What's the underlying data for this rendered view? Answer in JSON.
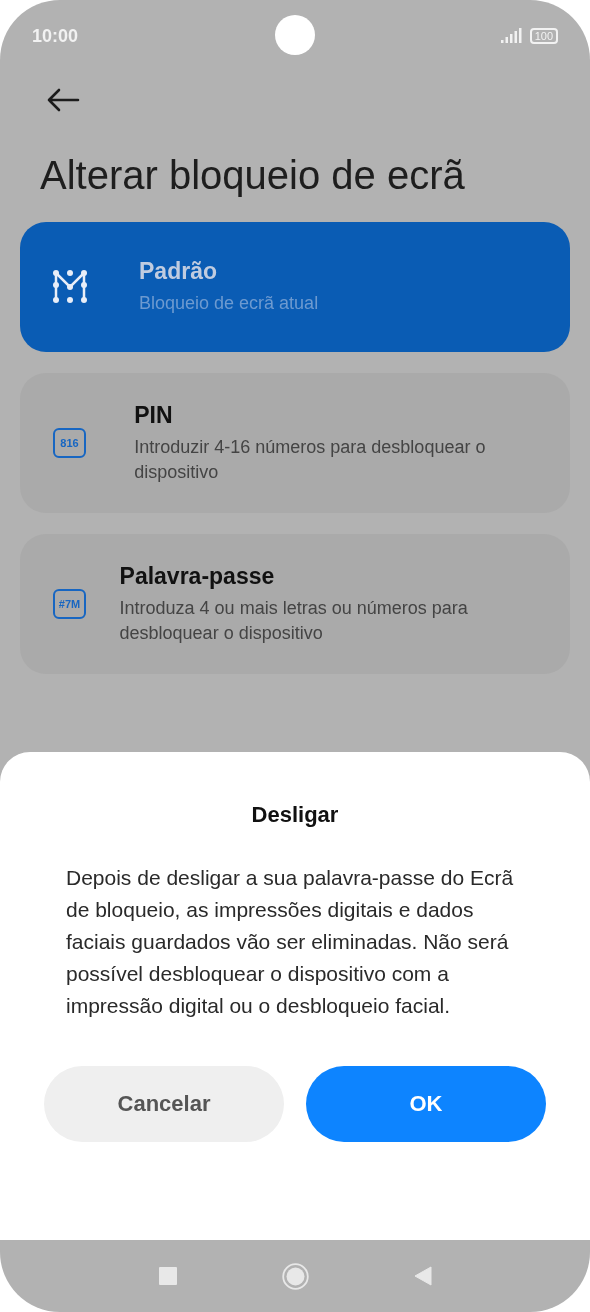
{
  "status_bar": {
    "time": "10:00",
    "battery": "100"
  },
  "header": {
    "title": "Alterar bloqueio de ecrã"
  },
  "options": [
    {
      "kind": "pattern",
      "title": "Padrão",
      "subtitle": "Bloqueio de ecrã atual",
      "selected": true
    },
    {
      "kind": "pin",
      "icon_text": "816",
      "title": "PIN",
      "subtitle": "Introduzir 4-16 números para desbloquear o dispositivo",
      "selected": false
    },
    {
      "kind": "password",
      "icon_text": "#7M",
      "title": "Palavra-passe",
      "subtitle": "Introduza 4 ou mais letras ou números para desbloquear o dispositivo",
      "selected": false
    }
  ],
  "dialog": {
    "title": "Desligar",
    "message": "Depois de desligar a sua palavra-passe do Ecrã de bloqueio, as impressões digitais e dados faciais guardados vão ser eliminadas. Não será possível desbloquear o dispositivo com a impressão digital ou o desbloqueio facial.",
    "buttons": [
      {
        "kind": "secondary",
        "label": "Cancelar"
      },
      {
        "kind": "primary",
        "label": "OK"
      }
    ]
  }
}
